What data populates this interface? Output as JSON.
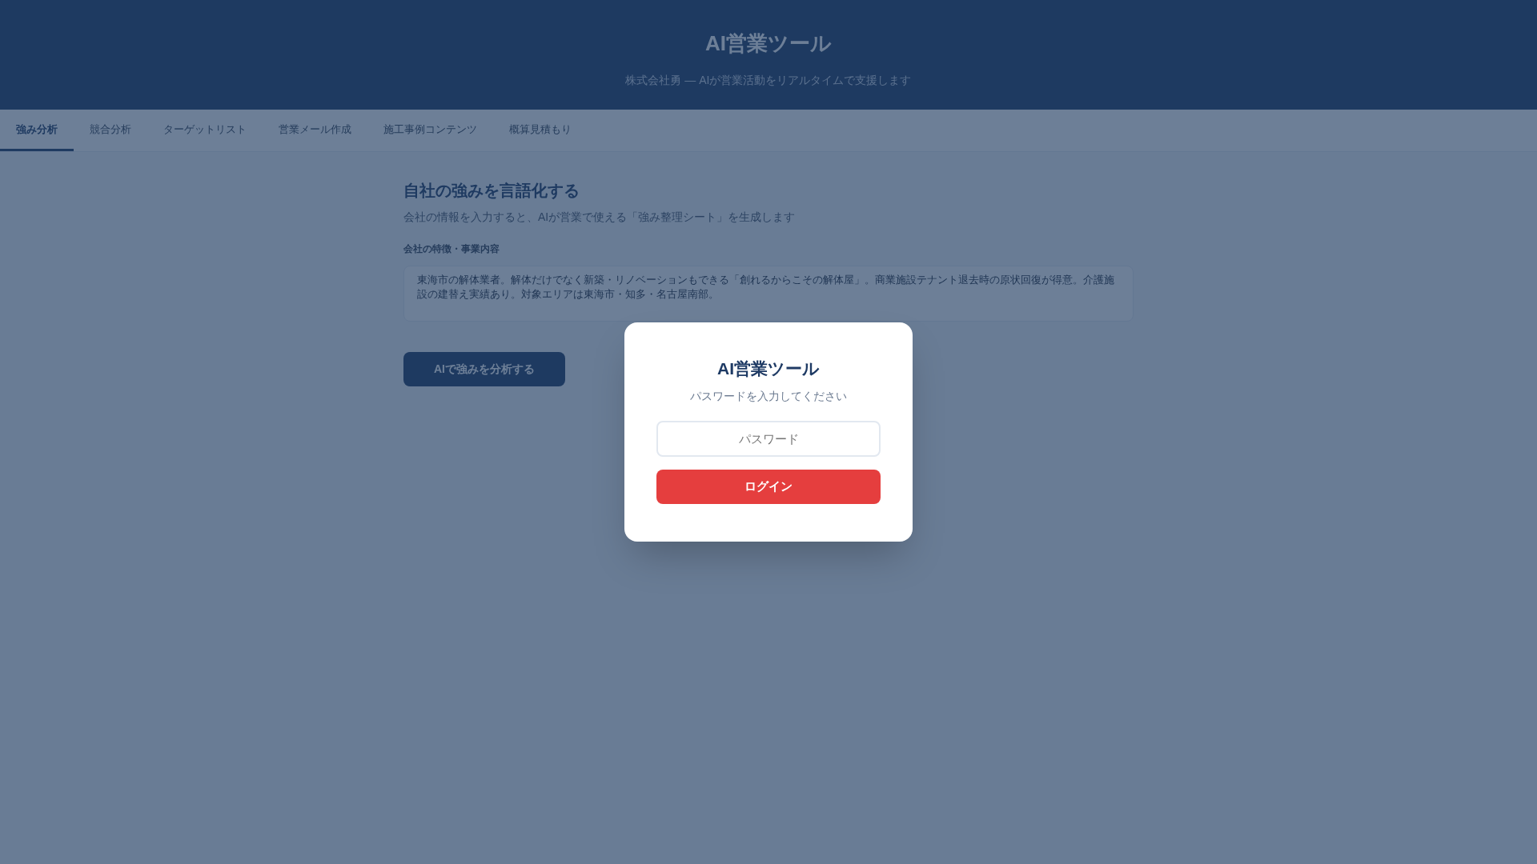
{
  "header": {
    "title": "AI営業ツール",
    "subtitle": "株式会社勇 — AIが営業活動をリアルタイムで支援します"
  },
  "tabs": [
    {
      "label": "強み分析",
      "selected": true
    },
    {
      "label": "競合分析",
      "selected": false
    },
    {
      "label": "ターゲットリスト",
      "selected": false
    },
    {
      "label": "営業メール作成",
      "selected": false
    },
    {
      "label": "施工事例コンテンツ",
      "selected": false
    },
    {
      "label": "概算見積もり",
      "selected": false
    }
  ],
  "section": {
    "title": "自社の強みを言語化する",
    "description": "会社の情報を入力すると、AIが営業で使える「強み整理シート」を生成します",
    "field_label": "会社の特徴・事業内容",
    "field_value": "東海市の解体業者。解体だけでなく新築・リノベーションもできる「創れるからこその解体屋」。商業施設テナント退去時の原状回復が得意。介護施設の建替え実績あり。対象エリアは東海市・知多・名古屋南部。",
    "button": "AIで強みを分析する"
  },
  "login_dialog": {
    "title": "AI営業ツール",
    "prompt": "パスワードを入力してください",
    "password_placeholder": "パスワード",
    "button": "ログイン"
  }
}
